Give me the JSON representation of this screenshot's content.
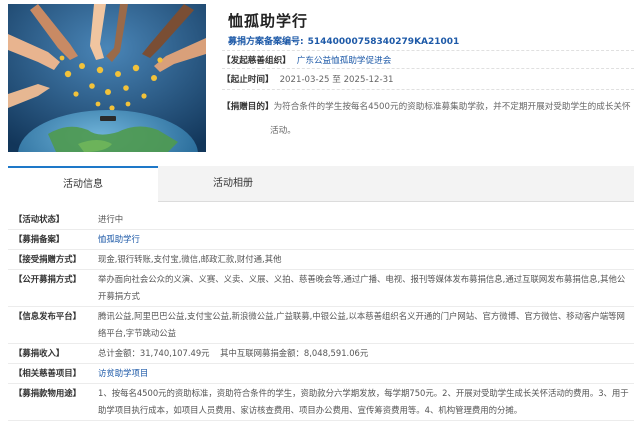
{
  "project": {
    "title": "恤孤助学行",
    "record_label": "募捐方案备案编号:",
    "record_no": "51440000758340279KA21001",
    "organizer_label": "【发起慈善组织】",
    "organizer": "广东公益恤孤助学促进会",
    "period_label": "【起止时间】",
    "period": "2021-03-25 至 2025-12-31",
    "purpose_label": "【捐赠目的】",
    "purpose": "为符合条件的学生按每名4500元的资助标准募集助学款，并不定期开展对受助学生的成长关怀活动。"
  },
  "tabs": [
    {
      "label": "活动信息",
      "active": true
    },
    {
      "label": "活动相册",
      "active": false
    }
  ],
  "details": [
    {
      "label": "【活动状态】",
      "value": "进行中"
    },
    {
      "label": "【募捐备案】",
      "value": "恤孤助学行",
      "link": true
    },
    {
      "label": "【接受捐赠方式】",
      "value": "现金,银行转账,支付宝,微信,邮政汇款,财付通,其他"
    },
    {
      "label": "【公开募捐方式】",
      "value": "举办面向社会公众的义演、义赛、义卖、义展、义拍、慈善晚会等,通过广播、电视、报刊等媒体发布募捐信息,通过互联网发布募捐信息,其他公开募捐方式"
    },
    {
      "label": "【信息发布平台】",
      "value": "腾讯公益,阿里巴巴公益,支付宝公益,新浪微公益,广益联募,中银公益,以本慈善组织名义开通的门户网站、官方微博、官方微信、移动客户端等网络平台,字节跳动公益"
    },
    {
      "label": "【募捐收入】",
      "value": "总计金额：31,740,107.49元    其中互联网募捐金额：8,048,591.06元"
    },
    {
      "label": "【相关慈善项目】",
      "value": "访贫助学项目",
      "link": true
    },
    {
      "label": "【募捐款物用途】",
      "value": "1、按每名4500元的资助标准，资助符合条件的学生，资助款分六学期发放，每学期750元。2、开展对受助学生成长关怀活动的费用。3、用于助学项目执行成本，如项目人员费用、家访核查费用、项目办公费用、宣传筹资费用等。4、机构管理费用的分摊。"
    }
  ],
  "colors": {
    "accent": "#1e5aa8",
    "tab_active_border": "#1e78c8"
  }
}
